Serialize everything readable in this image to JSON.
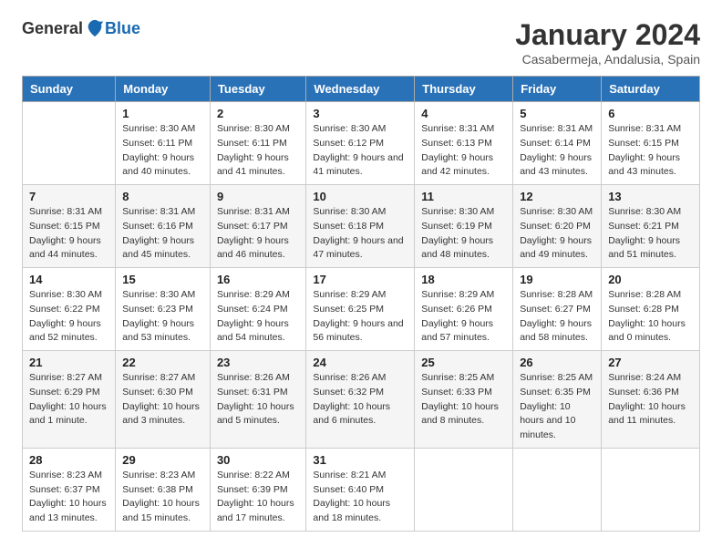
{
  "header": {
    "logo_general": "General",
    "logo_blue": "Blue",
    "title": "January 2024",
    "location": "Casabermeja, Andalusia, Spain"
  },
  "columns": [
    "Sunday",
    "Monday",
    "Tuesday",
    "Wednesday",
    "Thursday",
    "Friday",
    "Saturday"
  ],
  "weeks": [
    [
      {
        "day": "",
        "sunrise": "",
        "sunset": "",
        "daylight": ""
      },
      {
        "day": "1",
        "sunrise": "Sunrise: 8:30 AM",
        "sunset": "Sunset: 6:11 PM",
        "daylight": "Daylight: 9 hours and 40 minutes."
      },
      {
        "day": "2",
        "sunrise": "Sunrise: 8:30 AM",
        "sunset": "Sunset: 6:11 PM",
        "daylight": "Daylight: 9 hours and 41 minutes."
      },
      {
        "day": "3",
        "sunrise": "Sunrise: 8:30 AM",
        "sunset": "Sunset: 6:12 PM",
        "daylight": "Daylight: 9 hours and 41 minutes."
      },
      {
        "day": "4",
        "sunrise": "Sunrise: 8:31 AM",
        "sunset": "Sunset: 6:13 PM",
        "daylight": "Daylight: 9 hours and 42 minutes."
      },
      {
        "day": "5",
        "sunrise": "Sunrise: 8:31 AM",
        "sunset": "Sunset: 6:14 PM",
        "daylight": "Daylight: 9 hours and 43 minutes."
      },
      {
        "day": "6",
        "sunrise": "Sunrise: 8:31 AM",
        "sunset": "Sunset: 6:15 PM",
        "daylight": "Daylight: 9 hours and 43 minutes."
      }
    ],
    [
      {
        "day": "7",
        "sunrise": "Sunrise: 8:31 AM",
        "sunset": "Sunset: 6:15 PM",
        "daylight": "Daylight: 9 hours and 44 minutes."
      },
      {
        "day": "8",
        "sunrise": "Sunrise: 8:31 AM",
        "sunset": "Sunset: 6:16 PM",
        "daylight": "Daylight: 9 hours and 45 minutes."
      },
      {
        "day": "9",
        "sunrise": "Sunrise: 8:31 AM",
        "sunset": "Sunset: 6:17 PM",
        "daylight": "Daylight: 9 hours and 46 minutes."
      },
      {
        "day": "10",
        "sunrise": "Sunrise: 8:30 AM",
        "sunset": "Sunset: 6:18 PM",
        "daylight": "Daylight: 9 hours and 47 minutes."
      },
      {
        "day": "11",
        "sunrise": "Sunrise: 8:30 AM",
        "sunset": "Sunset: 6:19 PM",
        "daylight": "Daylight: 9 hours and 48 minutes."
      },
      {
        "day": "12",
        "sunrise": "Sunrise: 8:30 AM",
        "sunset": "Sunset: 6:20 PM",
        "daylight": "Daylight: 9 hours and 49 minutes."
      },
      {
        "day": "13",
        "sunrise": "Sunrise: 8:30 AM",
        "sunset": "Sunset: 6:21 PM",
        "daylight": "Daylight: 9 hours and 51 minutes."
      }
    ],
    [
      {
        "day": "14",
        "sunrise": "Sunrise: 8:30 AM",
        "sunset": "Sunset: 6:22 PM",
        "daylight": "Daylight: 9 hours and 52 minutes."
      },
      {
        "day": "15",
        "sunrise": "Sunrise: 8:30 AM",
        "sunset": "Sunset: 6:23 PM",
        "daylight": "Daylight: 9 hours and 53 minutes."
      },
      {
        "day": "16",
        "sunrise": "Sunrise: 8:29 AM",
        "sunset": "Sunset: 6:24 PM",
        "daylight": "Daylight: 9 hours and 54 minutes."
      },
      {
        "day": "17",
        "sunrise": "Sunrise: 8:29 AM",
        "sunset": "Sunset: 6:25 PM",
        "daylight": "Daylight: 9 hours and 56 minutes."
      },
      {
        "day": "18",
        "sunrise": "Sunrise: 8:29 AM",
        "sunset": "Sunset: 6:26 PM",
        "daylight": "Daylight: 9 hours and 57 minutes."
      },
      {
        "day": "19",
        "sunrise": "Sunrise: 8:28 AM",
        "sunset": "Sunset: 6:27 PM",
        "daylight": "Daylight: 9 hours and 58 minutes."
      },
      {
        "day": "20",
        "sunrise": "Sunrise: 8:28 AM",
        "sunset": "Sunset: 6:28 PM",
        "daylight": "Daylight: 10 hours and 0 minutes."
      }
    ],
    [
      {
        "day": "21",
        "sunrise": "Sunrise: 8:27 AM",
        "sunset": "Sunset: 6:29 PM",
        "daylight": "Daylight: 10 hours and 1 minute."
      },
      {
        "day": "22",
        "sunrise": "Sunrise: 8:27 AM",
        "sunset": "Sunset: 6:30 PM",
        "daylight": "Daylight: 10 hours and 3 minutes."
      },
      {
        "day": "23",
        "sunrise": "Sunrise: 8:26 AM",
        "sunset": "Sunset: 6:31 PM",
        "daylight": "Daylight: 10 hours and 5 minutes."
      },
      {
        "day": "24",
        "sunrise": "Sunrise: 8:26 AM",
        "sunset": "Sunset: 6:32 PM",
        "daylight": "Daylight: 10 hours and 6 minutes."
      },
      {
        "day": "25",
        "sunrise": "Sunrise: 8:25 AM",
        "sunset": "Sunset: 6:33 PM",
        "daylight": "Daylight: 10 hours and 8 minutes."
      },
      {
        "day": "26",
        "sunrise": "Sunrise: 8:25 AM",
        "sunset": "Sunset: 6:35 PM",
        "daylight": "Daylight: 10 hours and 10 minutes."
      },
      {
        "day": "27",
        "sunrise": "Sunrise: 8:24 AM",
        "sunset": "Sunset: 6:36 PM",
        "daylight": "Daylight: 10 hours and 11 minutes."
      }
    ],
    [
      {
        "day": "28",
        "sunrise": "Sunrise: 8:23 AM",
        "sunset": "Sunset: 6:37 PM",
        "daylight": "Daylight: 10 hours and 13 minutes."
      },
      {
        "day": "29",
        "sunrise": "Sunrise: 8:23 AM",
        "sunset": "Sunset: 6:38 PM",
        "daylight": "Daylight: 10 hours and 15 minutes."
      },
      {
        "day": "30",
        "sunrise": "Sunrise: 8:22 AM",
        "sunset": "Sunset: 6:39 PM",
        "daylight": "Daylight: 10 hours and 17 minutes."
      },
      {
        "day": "31",
        "sunrise": "Sunrise: 8:21 AM",
        "sunset": "Sunset: 6:40 PM",
        "daylight": "Daylight: 10 hours and 18 minutes."
      },
      {
        "day": "",
        "sunrise": "",
        "sunset": "",
        "daylight": ""
      },
      {
        "day": "",
        "sunrise": "",
        "sunset": "",
        "daylight": ""
      },
      {
        "day": "",
        "sunrise": "",
        "sunset": "",
        "daylight": ""
      }
    ]
  ]
}
